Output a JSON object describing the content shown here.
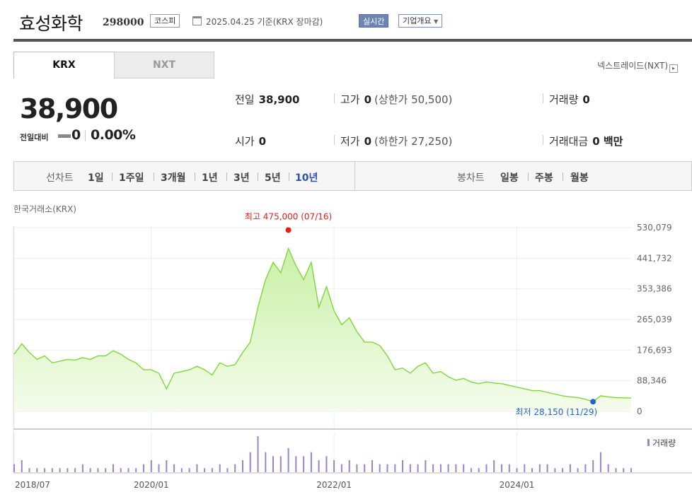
{
  "header": {
    "company_name": "효성화학",
    "stock_code": "298000",
    "market": "코스피",
    "base_date": "2025.04.25  기준(KRX 장마감)",
    "realtime_label": "실시간",
    "profile_label": "기업개요"
  },
  "tabs": [
    {
      "label": "KRX",
      "active": true
    },
    {
      "label": "NXT",
      "active": false
    }
  ],
  "nxt_link": "넥스트레이드(NXT)",
  "quote": {
    "price": "38,900",
    "change_label": "전일대비",
    "change_value": "0",
    "change_rate": "0.00%",
    "stats": {
      "prev_close": {
        "label": "전일",
        "value": "38,900"
      },
      "high": {
        "label": "고가",
        "value": "0",
        "sub": "(상한가 50,500)"
      },
      "volume": {
        "label": "거래량",
        "value": "0"
      },
      "open": {
        "label": "시가",
        "value": "0"
      },
      "low": {
        "label": "저가",
        "value": "0",
        "sub": "(하한가 27,250)"
      },
      "amount": {
        "label": "거래대금",
        "value": "0 백만"
      }
    }
  },
  "period_bar": {
    "line_label": "선차트",
    "line_periods": [
      "1일",
      "1주일",
      "3개월",
      "1년",
      "3년",
      "5년",
      "10년"
    ],
    "active_period": "10년",
    "candle_label": "봉차트",
    "candle_periods": [
      "일봉",
      "주봉",
      "월봉"
    ]
  },
  "chart_data": {
    "type": "area",
    "exchange_label": "한국거래소(KRX)",
    "y_ticks": [
      "530,079",
      "441,732",
      "353,386",
      "265,039",
      "176,693",
      "88,346",
      "0"
    ],
    "ylim": [
      0,
      530079
    ],
    "x_ticks": [
      "2018/07",
      "2020/01",
      "2022/01",
      "2024/01"
    ],
    "max_annotation": "최고 475,000 (07/16)",
    "min_annotation": "최저 28,150 (11/29)",
    "volume_label": "거래량",
    "colors": {
      "line": "#7fd63a",
      "fill_top": "#c9f0a6",
      "fill_bottom": "#f4fcec",
      "max": "#e0201b",
      "min": "#2563c9",
      "volume": "#9b85c9"
    },
    "series": [
      {
        "x": [
          "2018/07",
          "2018/08",
          "2018/09",
          "2018/10",
          "2018/11",
          "2018/12",
          "2019/01",
          "2019/02",
          "2019/03",
          "2019/04",
          "2019/05",
          "2019/06",
          "2019/07",
          "2019/08",
          "2019/09",
          "2019/10",
          "2019/11",
          "2019/12",
          "2020/01",
          "2020/02",
          "2020/03",
          "2020/04",
          "2020/05",
          "2020/06",
          "2020/07",
          "2020/08",
          "2020/09",
          "2020/10",
          "2020/11",
          "2020/12",
          "2021/01",
          "2021/02",
          "2021/03",
          "2021/04",
          "2021/05",
          "2021/06",
          "2021/07",
          "2021/08",
          "2021/09",
          "2021/10",
          "2021/11",
          "2021/12",
          "2022/01",
          "2022/02",
          "2022/03",
          "2022/04",
          "2022/05",
          "2022/06",
          "2022/07",
          "2022/08",
          "2022/09",
          "2022/10",
          "2022/11",
          "2022/12",
          "2023/01",
          "2023/02",
          "2023/03",
          "2023/04",
          "2023/05",
          "2023/06",
          "2023/07",
          "2023/08",
          "2023/09",
          "2023/10",
          "2023/11",
          "2023/12",
          "2024/01",
          "2024/02",
          "2024/03",
          "2024/04",
          "2024/05",
          "2024/06",
          "2024/07",
          "2024/08",
          "2024/09",
          "2024/10",
          "2024/11",
          "2024/12",
          "2025/01",
          "2025/02",
          "2025/03",
          "2025/04"
        ],
        "values": [
          165000,
          195000,
          170000,
          150000,
          160000,
          140000,
          145000,
          150000,
          148000,
          155000,
          150000,
          160000,
          160000,
          175000,
          165000,
          150000,
          140000,
          120000,
          120000,
          110000,
          65000,
          110000,
          115000,
          120000,
          130000,
          120000,
          105000,
          140000,
          130000,
          135000,
          170000,
          200000,
          300000,
          380000,
          430000,
          400000,
          470000,
          420000,
          380000,
          430000,
          300000,
          360000,
          290000,
          250000,
          270000,
          230000,
          200000,
          200000,
          190000,
          160000,
          120000,
          125000,
          110000,
          130000,
          140000,
          110000,
          115000,
          100000,
          90000,
          95000,
          85000,
          80000,
          85000,
          82000,
          80000,
          75000,
          70000,
          65000,
          60000,
          60000,
          55000,
          50000,
          45000,
          42000,
          40000,
          35000,
          28150,
          45000,
          42000,
          40000,
          39000,
          38900
        ]
      }
    ],
    "volume": [
      2,
      3,
      1,
      1,
      1,
      1,
      1,
      1,
      1,
      2,
      1,
      1,
      1,
      2,
      1,
      1,
      1,
      2,
      3,
      2,
      3,
      2,
      1,
      1,
      2,
      1,
      1,
      2,
      1,
      2,
      3,
      5,
      9,
      5,
      4,
      4,
      6,
      4,
      4,
      5,
      3,
      4,
      3,
      2,
      3,
      2,
      2,
      3,
      2,
      2,
      2,
      3,
      2,
      2,
      3,
      2,
      2,
      2,
      2,
      2,
      1,
      1,
      2,
      3,
      2,
      2,
      1,
      2,
      1,
      2,
      2,
      1,
      1,
      2,
      1,
      2,
      3,
      5,
      2,
      1,
      1,
      1
    ]
  }
}
